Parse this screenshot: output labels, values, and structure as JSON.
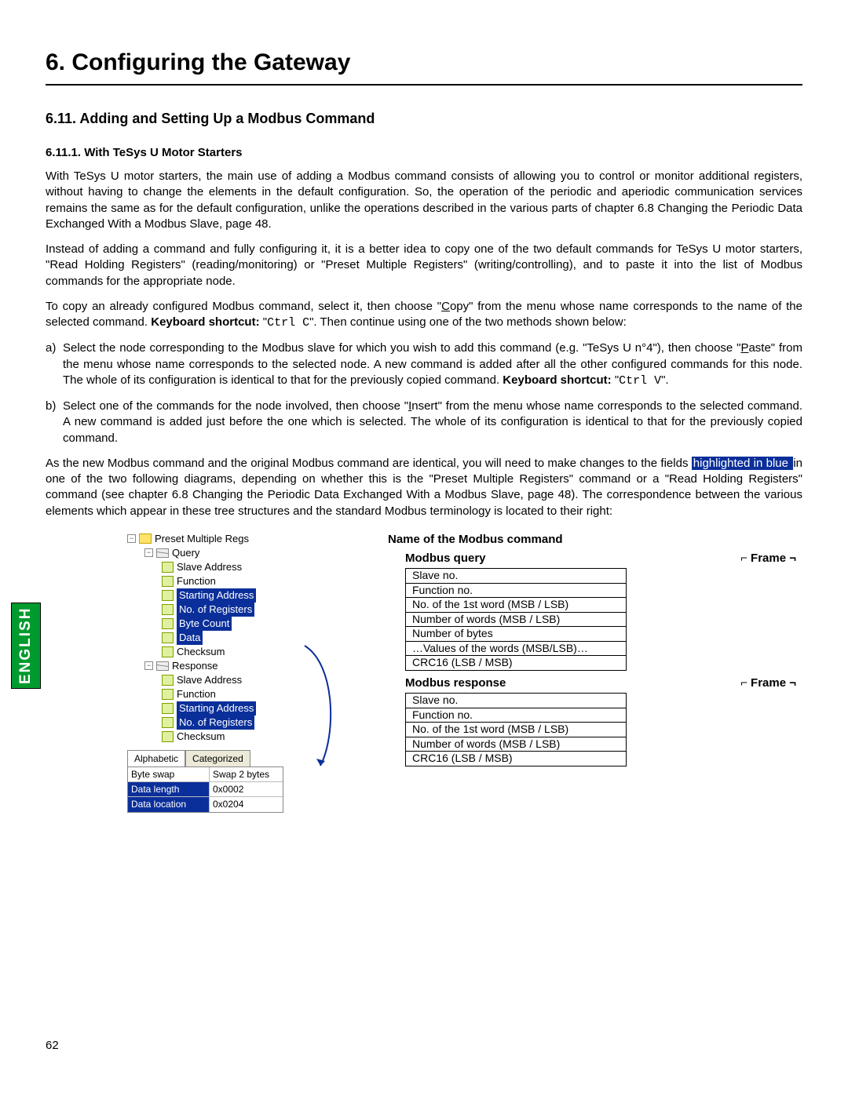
{
  "lang_tab": "ENGLISH",
  "page_number": "62",
  "h1": "6. Configuring the Gateway",
  "h2": "6.11. Adding and Setting Up a Modbus Command",
  "h3": "6.11.1. With TeSys U Motor Starters",
  "p1": "With TeSys U motor starters, the main use of adding a Modbus command consists of allowing you to control or monitor additional registers, without having to change the elements in the default configuration. So, the operation of the periodic and aperiodic communication services remains the same as for the default configuration, unlike the operations described in the various parts of chapter 6.8 Changing the Periodic Data Exchanged With a Modbus Slave, page 48.",
  "p2": "Instead of adding a command and fully configuring it, it is a better idea to copy one of the two default commands for TeSys U motor starters, \"Read Holding Registers\" (reading/monitoring) or \"Preset Multiple Registers\" (writing/controlling), and to paste it into the list of Modbus commands for the appropriate node.",
  "p3_a": "To copy an already configured Modbus command, select it, then choose \"",
  "p3_u": "C",
  "p3_b": "opy\" from the menu whose name corresponds to the name of the selected command. ",
  "p3_bold": "Keyboard shortcut:",
  "p3_c": " \"",
  "p3_kbd": "Ctrl C",
  "p3_d": "\". Then continue using one of the two methods shown below:",
  "li_a_mk": "a)",
  "li_a_1": "Select the node corresponding to the Modbus slave for which you wish to add this command (e.g. \"TeSys U n°4\"), then choose \"",
  "li_a_u": "P",
  "li_a_2": "aste\" from the menu whose name corresponds to the selected node. A new command is added after all the other configured commands for this node. The whole of its configuration is identical to that for the previously copied command. ",
  "li_a_bold": "Keyboard shortcut:",
  "li_a_3": " \"",
  "li_a_kbd": "Ctrl V",
  "li_a_4": "\".",
  "li_b_mk": "b)",
  "li_b_1": "Select one of the commands for the node involved, then choose \"",
  "li_b_u": "I",
  "li_b_2": "nsert\" from the menu whose name corresponds to the selected command. A new command is added just before the one which is selected. The whole of its configuration is identical to that for the previously copied command.",
  "p4_a": "As the new Modbus command and the original Modbus command are identical, you will need to make changes to the fields ",
  "p4_hl": " highlighted in blue ",
  "p4_b": " in one of the two following diagrams, depending on whether this is the \"Preset Multiple Registers\" command or a \"Read Holding Registers\" command (see chapter 6.8 Changing the Periodic Data Exchanged With a Modbus Slave, page 48). The correspondence between the various elements which appear in these tree structures and the standard Modbus terminology is located to their right:",
  "tree": {
    "root": "Preset Multiple Regs",
    "query": "Query",
    "response": "Response",
    "items_q": [
      "Slave Address",
      "Function",
      "Starting Address",
      "No. of Registers",
      "Byte Count",
      "Data",
      "Checksum"
    ],
    "items_r": [
      "Slave Address",
      "Function",
      "Starting Address",
      "No. of Registers",
      "Checksum"
    ],
    "hl_q": [
      2,
      3,
      4,
      5
    ],
    "hl_r": [
      2,
      3
    ]
  },
  "tabs": {
    "alpha": "Alphabetic",
    "cat": "Categorized"
  },
  "props": [
    {
      "k": "Byte swap",
      "v": "Swap 2 bytes",
      "sel": false
    },
    {
      "k": "Data length",
      "v": "0x0002",
      "sel": true
    },
    {
      "k": "Data location",
      "v": "0x0204",
      "sel": true
    }
  ],
  "right": {
    "cmdname": "Name of the Modbus command",
    "q_hdr": "Modbus query",
    "r_hdr": "Modbus response",
    "frame": "⌐ Frame ¬",
    "q_rows": [
      "Slave no.",
      "Function no.",
      "No. of the 1st word (MSB / LSB)",
      "Number of words (MSB / LSB)",
      "Number of bytes",
      "…Values of the words (MSB/LSB)…",
      "CRC16 (LSB / MSB)"
    ],
    "r_rows": [
      "Slave no.",
      "Function no.",
      "No. of the 1st word (MSB / LSB)",
      "Number of words (MSB / LSB)",
      "CRC16 (LSB / MSB)"
    ]
  }
}
